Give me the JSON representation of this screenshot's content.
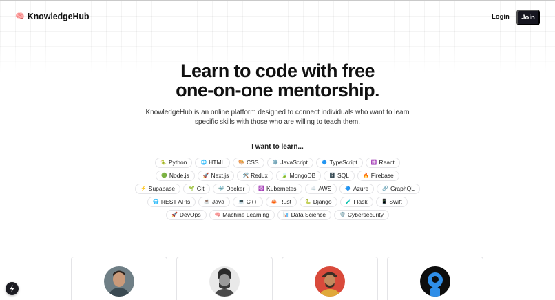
{
  "nav": {
    "logo_icon": "🧠",
    "logo_text": "KnowledgeHub",
    "login_label": "Login",
    "join_label": "Join"
  },
  "hero": {
    "title_line1": "Learn to code with free",
    "title_line2": "one-on-one mentorship.",
    "description": "KnowledgeHub is an online platform designed to connect individuals who want to learn specific skills with those who are willing to teach them."
  },
  "skills": {
    "heading": "I want to learn...",
    "rows": [
      [
        {
          "icon": "🐍",
          "label": "Python"
        },
        {
          "icon": "🌐",
          "label": "HTML"
        },
        {
          "icon": "🎨",
          "label": "CSS"
        },
        {
          "icon": "⚙️",
          "label": "JavaScript"
        },
        {
          "icon": "🔷",
          "label": "TypeScript"
        },
        {
          "icon": "⚛️",
          "label": "React"
        }
      ],
      [
        {
          "icon": "🟢",
          "label": "Node.js"
        },
        {
          "icon": "🚀",
          "label": "Next.js"
        },
        {
          "icon": "🛠️",
          "label": "Redux"
        },
        {
          "icon": "🍃",
          "label": "MongoDB"
        },
        {
          "icon": "🗄️",
          "label": "SQL"
        },
        {
          "icon": "🔥",
          "label": "Firebase"
        }
      ],
      [
        {
          "icon": "⚡",
          "label": "Supabase"
        },
        {
          "icon": "🌱",
          "label": "Git"
        },
        {
          "icon": "🐳",
          "label": "Docker"
        },
        {
          "icon": "☸️",
          "label": "Kubernetes"
        },
        {
          "icon": "☁️",
          "label": "AWS"
        },
        {
          "icon": "🔷",
          "label": "Azure"
        },
        {
          "icon": "🔗",
          "label": "GraphQL"
        }
      ],
      [
        {
          "icon": "🌐",
          "label": "REST APIs"
        },
        {
          "icon": "☕",
          "label": "Java"
        },
        {
          "icon": "💻",
          "label": "C++"
        },
        {
          "icon": "🦀",
          "label": "Rust"
        },
        {
          "icon": "🐍",
          "label": "Django"
        },
        {
          "icon": "🧪",
          "label": "Flask"
        },
        {
          "icon": "📱",
          "label": "Swift"
        }
      ],
      [
        {
          "icon": "🚀",
          "label": "DevOps"
        },
        {
          "icon": "🧠",
          "label": "Machine Learning"
        },
        {
          "icon": "📊",
          "label": "Data Science"
        },
        {
          "icon": "🛡️",
          "label": "Cybersecurity"
        }
      ]
    ]
  },
  "mentors": [
    {
      "avatar": "mentor-avatar-1"
    },
    {
      "avatar": "mentor-avatar-2"
    },
    {
      "avatar": "mentor-avatar-3"
    },
    {
      "avatar": "mentor-avatar-4"
    }
  ],
  "colors": {
    "join_bg": "#161620",
    "chip_border": "#e4e4e7",
    "card_border": "#e4e4e7"
  }
}
